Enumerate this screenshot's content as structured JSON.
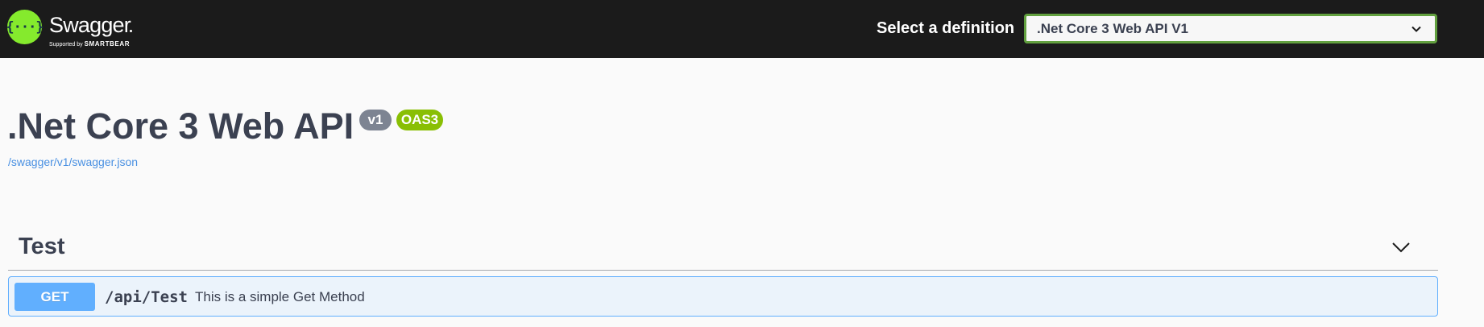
{
  "topbar": {
    "brand": "Swagger",
    "brand_sub_prefix": "Supported by",
    "brand_sub_company": "SMARTBEAR",
    "logo_glyph": "{···}",
    "definition_label": "Select a definition",
    "definition_selected": ".Net Core 3 Web API V1",
    "accent_color": "#85ea2d",
    "select_border_color": "#62a03f"
  },
  "info": {
    "title": ".Net Core 3 Web API",
    "version_badge": "v1",
    "oas_badge": "OAS3",
    "spec_url": "/swagger/v1/swagger.json"
  },
  "tags": [
    {
      "name": "Test",
      "expanded": true,
      "operations": [
        {
          "method": "GET",
          "path": "/api/Test",
          "summary": "This is a simple Get Method",
          "method_color": "#61affe"
        }
      ]
    }
  ]
}
